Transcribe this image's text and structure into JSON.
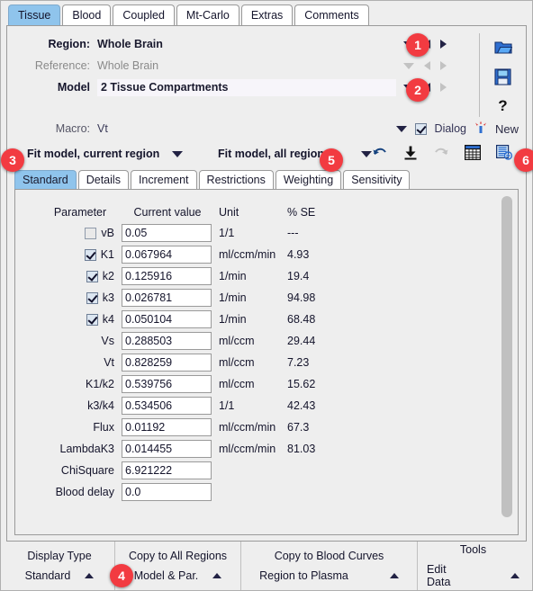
{
  "tabs": {
    "items": [
      {
        "label": "Tissue",
        "active": true
      },
      {
        "label": "Blood",
        "active": false
      },
      {
        "label": "Coupled",
        "active": false
      },
      {
        "label": "Mt-Carlo",
        "active": false
      },
      {
        "label": "Extras",
        "active": false
      },
      {
        "label": "Comments",
        "active": false
      }
    ]
  },
  "header": {
    "region_label": "Region:",
    "region_value": "Whole Brain",
    "reference_label": "Reference:",
    "reference_value": "Whole Brain",
    "model_label": "Model",
    "model_value": "2 Tissue Compartments",
    "macro_label": "Macro:",
    "macro_value": "Vt",
    "dialog_label": "Dialog",
    "new_label": "New"
  },
  "side_icons": [
    {
      "name": "open-folder-icon"
    },
    {
      "name": "save-disk-icon"
    },
    {
      "name": "help-question-icon"
    }
  ],
  "fitbar": {
    "fit_current": "Fit model, current region",
    "fit_all": "Fit model, all regions",
    "icons": [
      {
        "name": "undo-icon"
      },
      {
        "name": "download-icon"
      },
      {
        "name": "redo-icon"
      },
      {
        "name": "table-view-icon"
      },
      {
        "name": "inspect-report-icon"
      }
    ]
  },
  "subtabs": {
    "items": [
      {
        "label": "Standard",
        "active": true
      },
      {
        "label": "Details",
        "active": false
      },
      {
        "label": "Increment",
        "active": false
      },
      {
        "label": "Restrictions",
        "active": false
      },
      {
        "label": "Weighting",
        "active": false
      },
      {
        "label": "Sensitivity",
        "active": false
      }
    ]
  },
  "table": {
    "headers": {
      "parameter": "Parameter",
      "current_value": "Current value",
      "unit": "Unit",
      "se": "% SE"
    },
    "rows": [
      {
        "checkbox": "unchecked",
        "name": "vB",
        "value": "0.05",
        "unit": "1/1",
        "se": "---"
      },
      {
        "checkbox": "checked",
        "name": "K1",
        "value": "0.067964",
        "unit": "ml/ccm/min",
        "se": "4.93"
      },
      {
        "checkbox": "checked",
        "name": "k2",
        "value": "0.125916",
        "unit": "1/min",
        "se": "19.4"
      },
      {
        "checkbox": "checked",
        "name": "k3",
        "value": "0.026781",
        "unit": "1/min",
        "se": "94.98"
      },
      {
        "checkbox": "checked",
        "name": "k4",
        "value": "0.050104",
        "unit": "1/min",
        "se": "68.48"
      },
      {
        "checkbox": "none",
        "name": "Vs",
        "value": "0.288503",
        "unit": "ml/ccm",
        "se": "29.44"
      },
      {
        "checkbox": "none",
        "name": "Vt",
        "value": "0.828259",
        "unit": "ml/ccm",
        "se": "7.23"
      },
      {
        "checkbox": "none",
        "name": "K1/k2",
        "value": "0.539756",
        "unit": "ml/ccm",
        "se": "15.62"
      },
      {
        "checkbox": "none",
        "name": "k3/k4",
        "value": "0.534506",
        "unit": "1/1",
        "se": "42.43"
      },
      {
        "checkbox": "none",
        "name": "Flux",
        "value": "0.01192",
        "unit": "ml/ccm/min",
        "se": "67.3"
      },
      {
        "checkbox": "none",
        "name": "LambdaK3",
        "value": "0.014455",
        "unit": "ml/ccm/min",
        "se": "81.03"
      },
      {
        "checkbox": "none",
        "name": "ChiSquare",
        "value": "6.921222",
        "unit": "",
        "se": ""
      },
      {
        "checkbox": "none",
        "name": "Blood delay",
        "value": "0.0",
        "unit": "",
        "se": ""
      }
    ]
  },
  "bottom": {
    "sections": [
      {
        "title": "Display Type",
        "action": "Standard"
      },
      {
        "title": "Copy to All Regions",
        "action": "Model & Par."
      },
      {
        "title": "Copy to Blood Curves",
        "action": "Region to Plasma"
      },
      {
        "title": "Tools",
        "action": "Edit Data"
      }
    ]
  },
  "badges": [
    {
      "number": "1"
    },
    {
      "number": "2"
    },
    {
      "number": "3"
    },
    {
      "number": "4"
    },
    {
      "number": "5"
    },
    {
      "number": "6"
    }
  ],
  "colors": {
    "badge_red": "#f23b41",
    "tab_active_blue": "#8fc4ec",
    "panel_bg": "#eeeeee"
  }
}
